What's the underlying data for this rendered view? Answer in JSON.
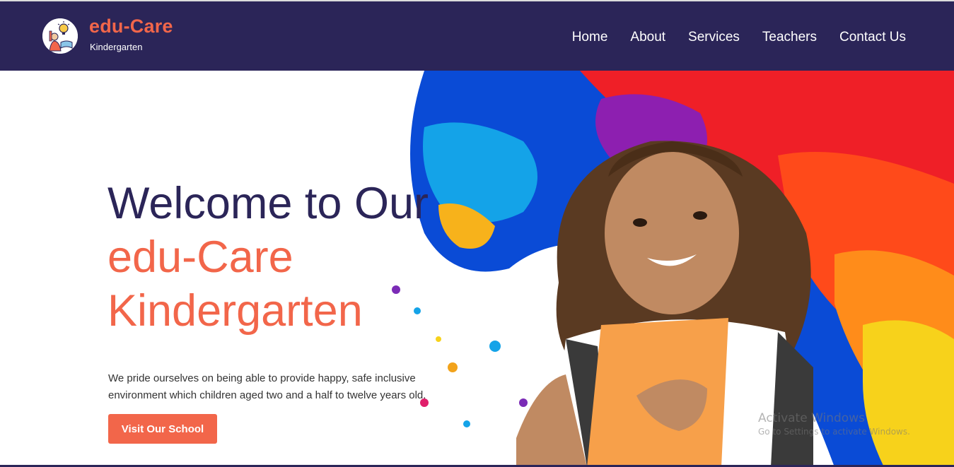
{
  "brand": {
    "name": "edu-Care",
    "tagline": "Kindergarten"
  },
  "nav": {
    "items": [
      {
        "label": "Home"
      },
      {
        "label": "About"
      },
      {
        "label": "Services"
      },
      {
        "label": "Teachers"
      },
      {
        "label": "Contact Us"
      }
    ]
  },
  "hero": {
    "title_line1": "Welcome to Our",
    "title_line2": "edu-Care",
    "title_line3": "Kindergarten",
    "description": "We pride ourselves on being able to provide happy, safe inclusive environment which children aged two and a half to twelve years old.",
    "cta_label": "Visit Our School"
  },
  "watermark": {
    "line1": "Activate Windows",
    "line2": "Go to Settings to activate Windows."
  },
  "colors": {
    "navbar_bg": "#2b2558",
    "accent": "#f2664a",
    "heading_dark": "#2b2558"
  },
  "icons": {
    "logo": "child-lightbulb-icon"
  }
}
